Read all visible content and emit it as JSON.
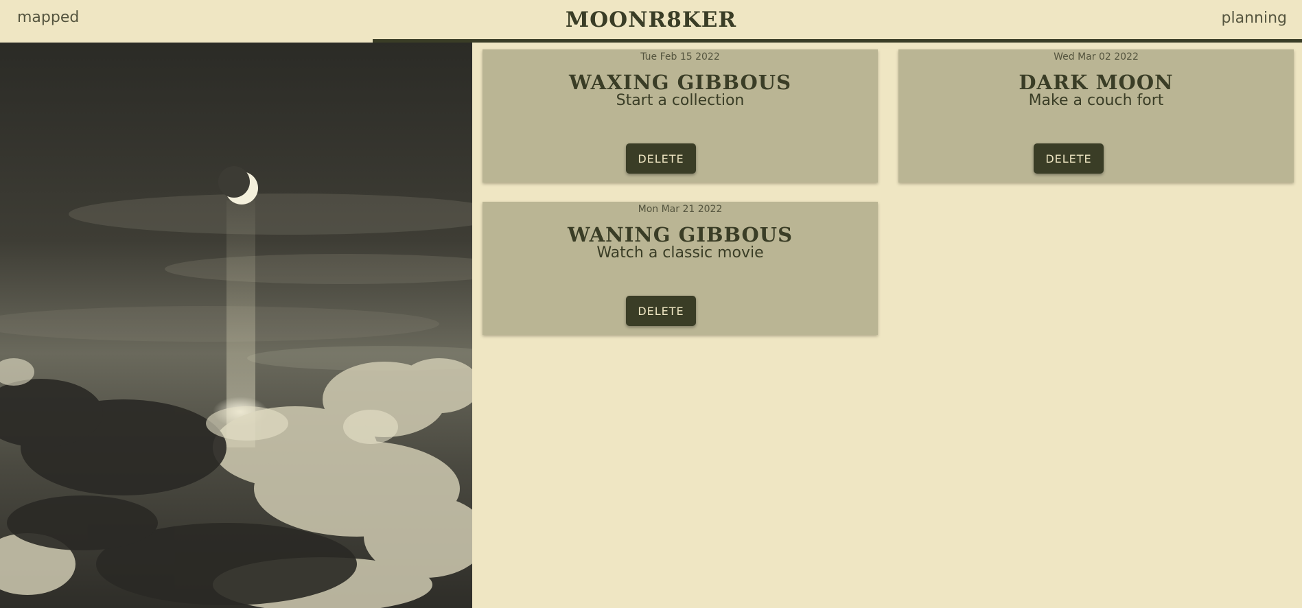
{
  "nav": {
    "left_link": "mapped",
    "brand": "MOONR8KER",
    "right_link": "planning"
  },
  "colors": {
    "background": "#efe6c3",
    "card": "#bab594",
    "accent_dark": "#3a3d26",
    "button_text": "#efe6c3"
  },
  "hero_image": {
    "subject": "crescent moon above clouds",
    "icon": "moon-photo"
  },
  "cards": [
    {
      "date": "Tue Feb 15 2022",
      "phase": "WAXING GIBBOUS",
      "activity": "Start a collection",
      "delete_label": "DELETE"
    },
    {
      "date": "Wed Mar 02 2022",
      "phase": "DARK MOON",
      "activity": "Make a couch fort",
      "delete_label": "DELETE"
    },
    {
      "date": "Mon Mar 21 2022",
      "phase": "WANING GIBBOUS",
      "activity": "Watch a classic movie",
      "delete_label": "DELETE"
    }
  ]
}
